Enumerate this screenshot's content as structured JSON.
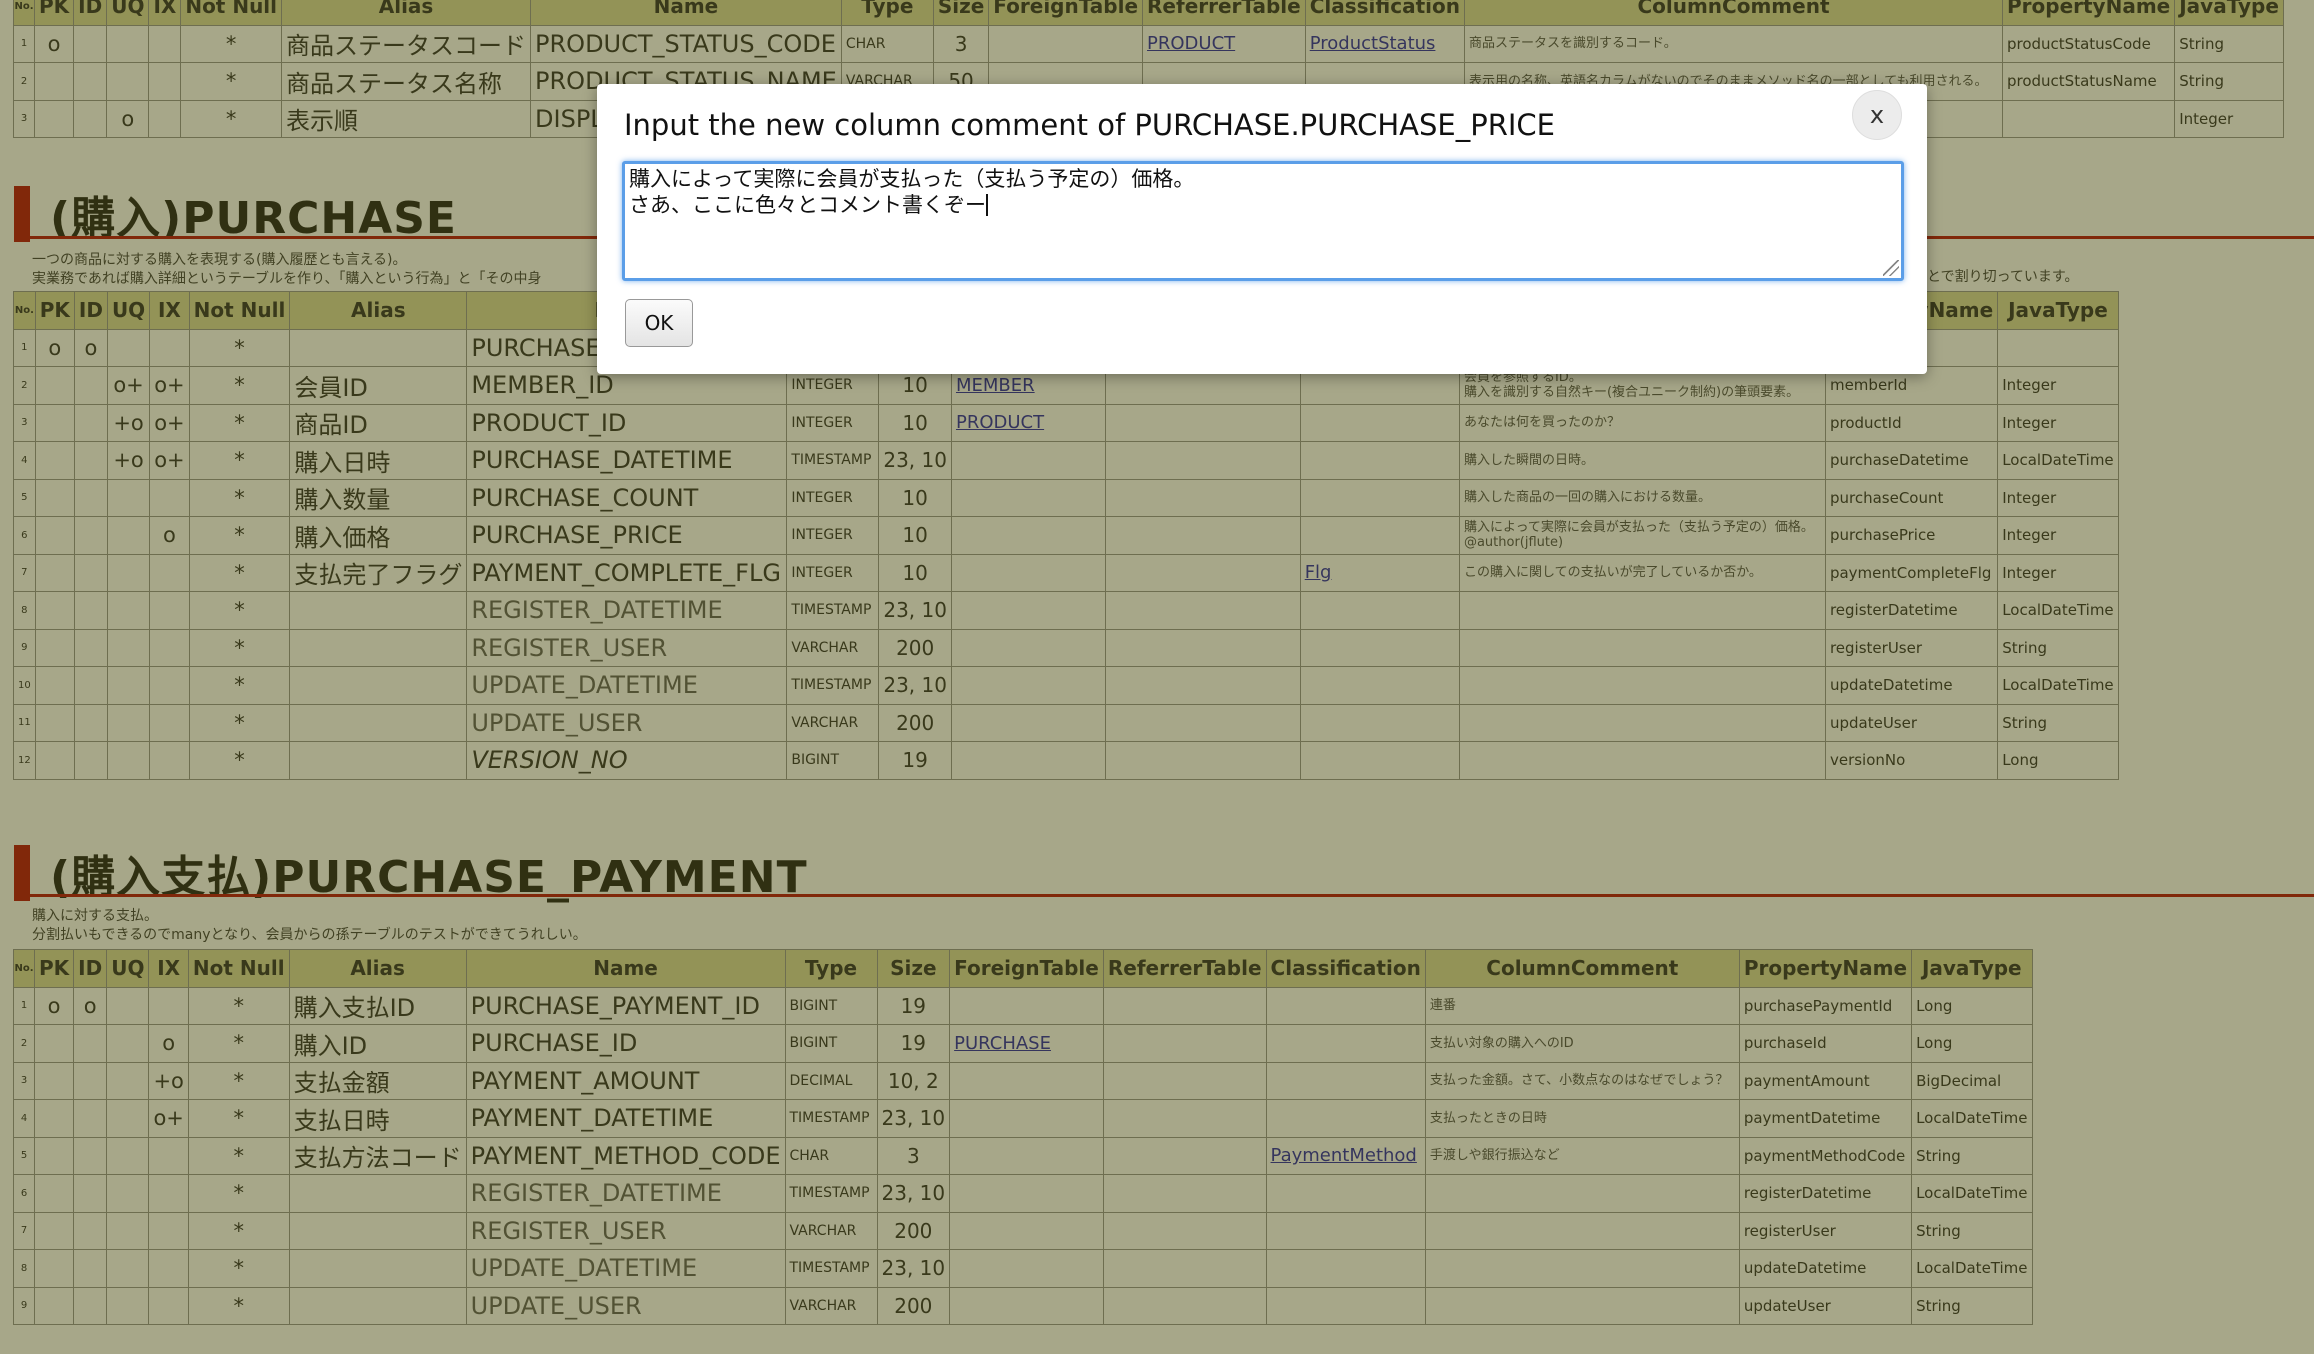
{
  "headers": [
    "No.",
    "PK",
    "ID",
    "UQ",
    "IX",
    "Not Null",
    "Alias",
    "Name",
    "Type",
    "Size",
    "ForeignTable",
    "ReferrerTable",
    "Classification",
    "ColumnComment",
    "PropertyName",
    "JavaType"
  ],
  "top_table": {
    "rows": [
      {
        "no": "1",
        "pk": "o",
        "id": "",
        "uq": "",
        "ix": "",
        "nn": "*",
        "alias": "商品ステータスコード",
        "name": "PRODUCT_STATUS_CODE",
        "type": "CHAR",
        "size": "3",
        "fk": "",
        "ref": "PRODUCT",
        "cls": "ProductStatus",
        "comment": "商品ステータスを識別するコード。",
        "prop": "productStatusCode",
        "jtype": "String"
      },
      {
        "no": "2",
        "pk": "",
        "id": "",
        "uq": "",
        "ix": "",
        "nn": "*",
        "alias": "商品ステータス名称",
        "name": "PRODUCT_STATUS_NAME",
        "type": "VARCHAR",
        "size": "50",
        "fk": "",
        "ref": "",
        "cls": "",
        "comment": "表示用の名称、英語名カラムがないのでそのままメソッド名の一部としても利用される。",
        "prop": "productStatusName",
        "jtype": "String"
      },
      {
        "no": "3",
        "pk": "",
        "id": "",
        "uq": "o",
        "ix": "",
        "nn": "*",
        "alias": "表示順",
        "name": "DISPLAY_ORD",
        "type": "",
        "size": "",
        "fk": "",
        "ref": "",
        "cls": "",
        "comment": "",
        "prop": "",
        "jtype": "Integer"
      }
    ]
  },
  "purchase": {
    "title": "(購入)PURCHASE",
    "desc": "一つの商品に対する購入を表現する(購入履歴とも言える)。\n実業務であれば購入詳細というテーブルを作り、「購入という行為」と「その中身",
    "desc_tail": "とで割り切っています。",
    "rows": [
      {
        "no": "1",
        "pk": "o",
        "id": "o",
        "uq": "",
        "ix": "",
        "nn": "*",
        "alias": "",
        "name": "PURCHASE_ID",
        "type": "",
        "size": "",
        "fk": "",
        "ref": "",
        "cls": "",
        "comment": "",
        "prop": "",
        "jtype": "",
        "style": ""
      },
      {
        "no": "2",
        "pk": "",
        "id": "",
        "uq": "o+",
        "ix": "o+",
        "nn": "*",
        "alias": "会員ID",
        "name": "MEMBER_ID",
        "type": "INTEGER",
        "size": "10",
        "fk": "MEMBER",
        "ref": "",
        "cls": "",
        "comment": "会員を参照するID。\n購入を識別する自然キー(複合ユニーク制約)の筆頭要素。",
        "prop": "memberId",
        "jtype": "Integer",
        "style": ""
      },
      {
        "no": "3",
        "pk": "",
        "id": "",
        "uq": "+o",
        "ix": "o+",
        "nn": "*",
        "alias": "商品ID",
        "name": "PRODUCT_ID",
        "type": "INTEGER",
        "size": "10",
        "fk": "PRODUCT",
        "ref": "",
        "cls": "",
        "comment": "あなたは何を買ったのか？",
        "prop": "productId",
        "jtype": "Integer",
        "style": ""
      },
      {
        "no": "4",
        "pk": "",
        "id": "",
        "uq": "+o",
        "ix": "o+",
        "nn": "*",
        "alias": "購入日時",
        "name": "PURCHASE_DATETIME",
        "type": "TIMESTAMP",
        "size": "23, 10",
        "fk": "",
        "ref": "",
        "cls": "",
        "comment": "購入した瞬間の日時。",
        "prop": "purchaseDatetime",
        "jtype": "LocalDateTime",
        "style": ""
      },
      {
        "no": "5",
        "pk": "",
        "id": "",
        "uq": "",
        "ix": "",
        "nn": "*",
        "alias": "購入数量",
        "name": "PURCHASE_COUNT",
        "type": "INTEGER",
        "size": "10",
        "fk": "",
        "ref": "",
        "cls": "",
        "comment": "購入した商品の一回の購入における数量。",
        "prop": "purchaseCount",
        "jtype": "Integer",
        "style": ""
      },
      {
        "no": "6",
        "pk": "",
        "id": "",
        "uq": "",
        "ix": "o",
        "nn": "*",
        "alias": "購入価格",
        "name": "PURCHASE_PRICE",
        "type": "INTEGER",
        "size": "10",
        "fk": "",
        "ref": "",
        "cls": "",
        "comment": "購入によって実際に会員が支払った（支払う予定の）価格。\n@author(jflute)",
        "prop": "purchasePrice",
        "jtype": "Integer",
        "style": ""
      },
      {
        "no": "7",
        "pk": "",
        "id": "",
        "uq": "",
        "ix": "",
        "nn": "*",
        "alias": "支払完了フラグ",
        "name": "PAYMENT_COMPLETE_FLG",
        "type": "INTEGER",
        "size": "10",
        "fk": "",
        "ref": "",
        "cls": "Flg",
        "comment": "この購入に関しての支払いが完了しているか否か。",
        "prop": "paymentCompleteFlg",
        "jtype": "Integer",
        "style": ""
      },
      {
        "no": "8",
        "pk": "",
        "id": "",
        "uq": "",
        "ix": "",
        "nn": "*",
        "alias": "",
        "name": "REGISTER_DATETIME",
        "type": "TIMESTAMP",
        "size": "23, 10",
        "fk": "",
        "ref": "",
        "cls": "",
        "comment": "",
        "prop": "registerDatetime",
        "jtype": "LocalDateTime",
        "style": "common"
      },
      {
        "no": "9",
        "pk": "",
        "id": "",
        "uq": "",
        "ix": "",
        "nn": "*",
        "alias": "",
        "name": "REGISTER_USER",
        "type": "VARCHAR",
        "size": "200",
        "fk": "",
        "ref": "",
        "cls": "",
        "comment": "",
        "prop": "registerUser",
        "jtype": "String",
        "style": "common"
      },
      {
        "no": "10",
        "pk": "",
        "id": "",
        "uq": "",
        "ix": "",
        "nn": "*",
        "alias": "",
        "name": "UPDATE_DATETIME",
        "type": "TIMESTAMP",
        "size": "23, 10",
        "fk": "",
        "ref": "",
        "cls": "",
        "comment": "",
        "prop": "updateDatetime",
        "jtype": "LocalDateTime",
        "style": "common"
      },
      {
        "no": "11",
        "pk": "",
        "id": "",
        "uq": "",
        "ix": "",
        "nn": "*",
        "alias": "",
        "name": "UPDATE_USER",
        "type": "VARCHAR",
        "size": "200",
        "fk": "",
        "ref": "",
        "cls": "",
        "comment": "",
        "prop": "updateUser",
        "jtype": "String",
        "style": "common"
      },
      {
        "no": "12",
        "pk": "",
        "id": "",
        "uq": "",
        "ix": "",
        "nn": "*",
        "alias": "",
        "name": "VERSION_NO",
        "type": "BIGINT",
        "size": "19",
        "fk": "",
        "ref": "",
        "cls": "",
        "comment": "",
        "prop": "versionNo",
        "jtype": "Long",
        "style": "italic"
      }
    ]
  },
  "payment": {
    "title": "(購入支払)PURCHASE_PAYMENT",
    "desc": "購入に対する支払。\n分割払いもできるのでmanyとなり、会員からの孫テーブルのテストができてうれしい。",
    "rows": [
      {
        "no": "1",
        "pk": "o",
        "id": "o",
        "uq": "",
        "ix": "",
        "nn": "*",
        "alias": "購入支払ID",
        "name": "PURCHASE_PAYMENT_ID",
        "type": "BIGINT",
        "size": "19",
        "fk": "",
        "ref": "",
        "cls": "",
        "comment": "連番",
        "prop": "purchasePaymentId",
        "jtype": "Long",
        "style": ""
      },
      {
        "no": "2",
        "pk": "",
        "id": "",
        "uq": "",
        "ix": "o",
        "nn": "*",
        "alias": "購入ID",
        "name": "PURCHASE_ID",
        "type": "BIGINT",
        "size": "19",
        "fk": "PURCHASE",
        "ref": "",
        "cls": "",
        "comment": "支払い対象の購入へのID",
        "prop": "purchaseId",
        "jtype": "Long",
        "style": ""
      },
      {
        "no": "3",
        "pk": "",
        "id": "",
        "uq": "",
        "ix": "+o",
        "nn": "*",
        "alias": "支払金額",
        "name": "PAYMENT_AMOUNT",
        "type": "DECIMAL",
        "size": "10, 2",
        "fk": "",
        "ref": "",
        "cls": "",
        "comment": "支払った金額。さて、小数点なのはなぜでしょう？",
        "prop": "paymentAmount",
        "jtype": "BigDecimal",
        "style": ""
      },
      {
        "no": "4",
        "pk": "",
        "id": "",
        "uq": "",
        "ix": "o+",
        "nn": "*",
        "alias": "支払日時",
        "name": "PAYMENT_DATETIME",
        "type": "TIMESTAMP",
        "size": "23, 10",
        "fk": "",
        "ref": "",
        "cls": "",
        "comment": "支払ったときの日時",
        "prop": "paymentDatetime",
        "jtype": "LocalDateTime",
        "style": ""
      },
      {
        "no": "5",
        "pk": "",
        "id": "",
        "uq": "",
        "ix": "",
        "nn": "*",
        "alias": "支払方法コード",
        "name": "PAYMENT_METHOD_CODE",
        "type": "CHAR",
        "size": "3",
        "fk": "",
        "ref": "",
        "cls": "PaymentMethod",
        "comment": "手渡しや銀行振込など",
        "prop": "paymentMethodCode",
        "jtype": "String",
        "style": ""
      },
      {
        "no": "6",
        "pk": "",
        "id": "",
        "uq": "",
        "ix": "",
        "nn": "*",
        "alias": "",
        "name": "REGISTER_DATETIME",
        "type": "TIMESTAMP",
        "size": "23, 10",
        "fk": "",
        "ref": "",
        "cls": "",
        "comment": "",
        "prop": "registerDatetime",
        "jtype": "LocalDateTime",
        "style": "common"
      },
      {
        "no": "7",
        "pk": "",
        "id": "",
        "uq": "",
        "ix": "",
        "nn": "*",
        "alias": "",
        "name": "REGISTER_USER",
        "type": "VARCHAR",
        "size": "200",
        "fk": "",
        "ref": "",
        "cls": "",
        "comment": "",
        "prop": "registerUser",
        "jtype": "String",
        "style": "common"
      },
      {
        "no": "8",
        "pk": "",
        "id": "",
        "uq": "",
        "ix": "",
        "nn": "*",
        "alias": "",
        "name": "UPDATE_DATETIME",
        "type": "TIMESTAMP",
        "size": "23, 10",
        "fk": "",
        "ref": "",
        "cls": "",
        "comment": "",
        "prop": "updateDatetime",
        "jtype": "LocalDateTime",
        "style": "common"
      },
      {
        "no": "9",
        "pk": "",
        "id": "",
        "uq": "",
        "ix": "",
        "nn": "*",
        "alias": "",
        "name": "UPDATE_USER",
        "type": "VARCHAR",
        "size": "200",
        "fk": "",
        "ref": "",
        "cls": "",
        "comment": "",
        "prop": "updateUser",
        "jtype": "String",
        "style": "common"
      }
    ]
  },
  "dialog": {
    "title": "Input the new column comment of PURCHASE.PURCHASE_PRICE",
    "close_label": "x",
    "comment_value": "購入によって実際に会員が支払った（支払う予定の）価格。\nさあ、ここに色々とコメント書くぞー",
    "ok_label": "OK"
  },
  "colors": {
    "header_bg": "#d6d69a",
    "accent_red": "#b30000",
    "link": "#1a1aa6",
    "focus_ring": "#5b9ee8"
  }
}
